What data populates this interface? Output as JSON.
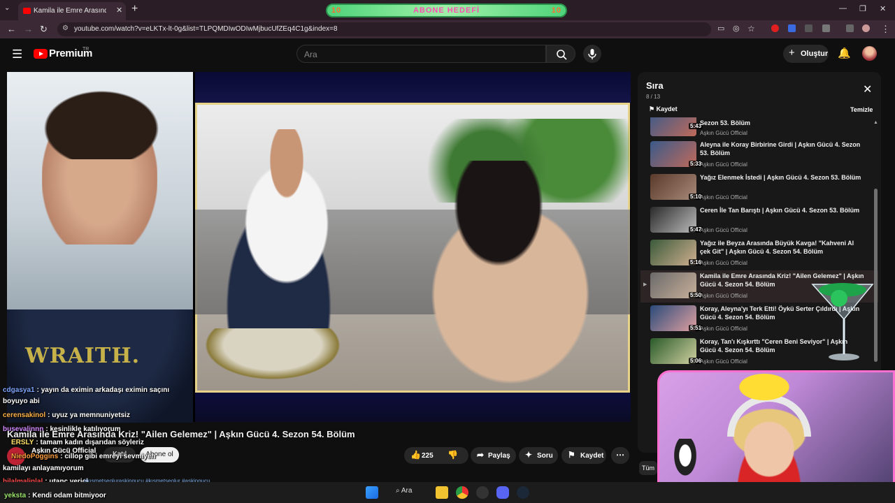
{
  "browser": {
    "tab_title": "Kamila ile Emre Arasında Kriz!",
    "tab_close": "✕",
    "new_tab": "+",
    "url": "youtube.com/watch?v=eLKTx-lt-0g&list=TLPQMDIwODIwMjbucUfZEq4C1g&index=8",
    "banner_text": "ABONE HEDEFİ",
    "banner_left": "10",
    "banner_right": "10"
  },
  "header": {
    "logo_text": "Premium",
    "logo_region": "TR",
    "search_placeholder": "Ara",
    "create_label": "Oluştur"
  },
  "player": {
    "overlay_text": "WRAITH."
  },
  "chat": [
    {
      "user": "cdgasya1",
      "message": ": yayın da eximin arkadaşı eximin saçını",
      "color": "#7fa7ff"
    },
    {
      "user": "",
      "message": "boyuyo abi",
      "color": "#ffffff"
    },
    {
      "user": "cerensakinol",
      "message": ": uyuz ya memnuniyetsiz",
      "color": "#ffb347"
    },
    {
      "user": "busevalinnn",
      "message": ": kesinlikle katılıyorum",
      "color": "#d58cff"
    },
    {
      "user": "ERSLY",
      "message": ": tamam kadın dışarıdan söyleriz",
      "color": "#ffe066"
    },
    {
      "user": "NiedoPoggins",
      "message": ": cillop gibi emreyi sevmiyen",
      "color": "#ff9f40"
    },
    {
      "user": "",
      "message": "kamilayı anlayamıyorum",
      "color": "#ffffff"
    },
    {
      "user": "hilalmalinlal",
      "message": ": utanç verici",
      "color": "#ff4d4d"
    }
  ],
  "video": {
    "title": "Kamila ile Emre Arasında Kriz! \"Ailen Gelemez\" | Aşkın Gücü 4. Sezon 54. Bölüm",
    "channel": "Aşkın Gücü Official",
    "join_label": "Katıl",
    "subscribe_label": "Abone ol",
    "likes": "225",
    "share_label": "Paylaş",
    "ask_label": "Soru",
    "save_label": "Kaydet",
    "tags": "#kısmetseoluraskingucu #kısmetseolur #askingucu"
  },
  "queue": {
    "title": "Sıra",
    "count": "8 / 13",
    "save_label": "Kaydet",
    "clear_label": "Temizle",
    "items": [
      {
        "title": "Sezon 53. Bölüm",
        "channel": "Aşkın Gücü Official",
        "duration": "5:43",
        "active": false
      },
      {
        "title": "Aleyna ile Koray Birbirine Girdi | Aşkın Gücü 4. Sezon 53. Bölüm",
        "channel": "Aşkın Gücü Official",
        "duration": "5:33",
        "active": false
      },
      {
        "title": "Yağız Elenmek İstedi | Aşkın Gücü 4. Sezon 53. Bölüm",
        "channel": "Aşkın Gücü Official",
        "duration": "5:10",
        "active": false
      },
      {
        "title": "Ceren İle Tan Barıştı | Aşkın Gücü 4. Sezon 53. Bölüm",
        "channel": "Aşkın Gücü Official",
        "duration": "5:47",
        "active": false
      },
      {
        "title": "Yağız ile Beyza Arasında Büyük Kavga! \"Kahveni Al çek Git\" | Aşkın Gücü 4. Sezon 54. Bölüm",
        "channel": "Aşkın Gücü Official",
        "duration": "5:16",
        "active": false
      },
      {
        "title": "Kamila ile Emre Arasında Kriz! \"Ailen Gelemez\" | Aşkın Gücü 4. Sezon 54. Bölüm",
        "channel": "Aşkın Gücü Official",
        "duration": "5:50",
        "active": true
      },
      {
        "title": "Koray, Aleyna'yı Terk Etti! Öykü Serter Çıldırdı | Aşkın Gücü 4. Sezon 54. Bölüm",
        "channel": "Aşkın Gücü Official",
        "duration": "5:51",
        "active": false
      },
      {
        "title": "Koray, Tan'ı Kışkırttı \"Ceren Beni Seviyor\" | Aşkın Gücü 4. Sezon 54. Bölüm",
        "channel": "Aşkın Gücü Official",
        "duration": "5:06",
        "active": false
      }
    ]
  },
  "below_queue": {
    "chip_label": "Tüm"
  },
  "taskbar": {
    "search_label": "Ara"
  },
  "bottom_chat": {
    "user": "yeksta",
    "message": ": Kendi odam bitmiyoor"
  }
}
